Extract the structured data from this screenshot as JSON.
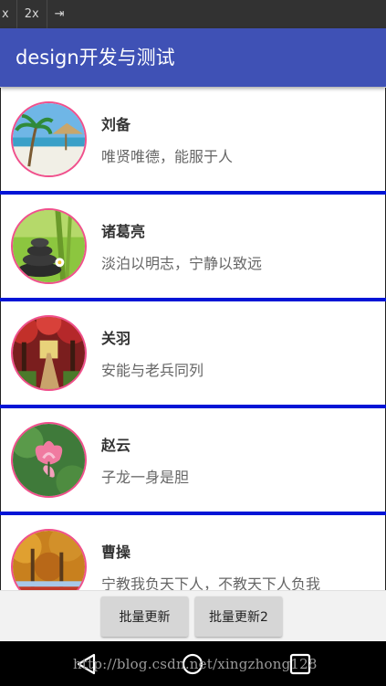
{
  "emulator": {
    "buttons": [
      "x",
      "2x",
      "⇥"
    ]
  },
  "app": {
    "title": "design开发与测试",
    "theme_color": "#3f51b5",
    "divider_color": "#0015d6",
    "avatar_border_color": "#f0508c"
  },
  "list": {
    "items": [
      {
        "name": "刘备",
        "motto": "唯贤唯德，能服于人",
        "avatar": "beach-hut-image"
      },
      {
        "name": "诸葛亮",
        "motto": "淡泊以明志，宁静以致远",
        "avatar": "bamboo-stones-image"
      },
      {
        "name": "关羽",
        "motto": "安能与老兵同列",
        "avatar": "tree-path-image"
      },
      {
        "name": "赵云",
        "motto": "子龙一身是胆",
        "avatar": "lotus-flower-image"
      },
      {
        "name": "曹操",
        "motto": "宁教我负天下人，不教天下人负我",
        "avatar": "autumn-forest-image"
      }
    ]
  },
  "buttons": {
    "batch_update": "批量更新",
    "batch_update2": "批量更新2"
  },
  "navbar": {
    "icons": [
      "back-icon",
      "home-icon",
      "recent-apps-icon"
    ]
  },
  "watermark": "http://blog.csdn.net/xingzhong128"
}
